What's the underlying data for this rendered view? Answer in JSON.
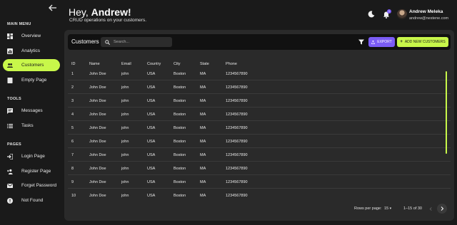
{
  "sidebar": {
    "sections": [
      {
        "title": "MAIN MENU",
        "items": [
          {
            "label": "Overview",
            "icon": "dashboard-icon",
            "active": false
          },
          {
            "label": "Analytics",
            "icon": "analytics-icon",
            "active": false
          },
          {
            "label": "Customers",
            "icon": "people-icon",
            "active": true
          },
          {
            "label": "Empty Page",
            "icon": "page-icon",
            "active": false
          }
        ]
      },
      {
        "title": "TOOLS",
        "items": [
          {
            "label": "Messages",
            "icon": "message-icon",
            "active": false
          },
          {
            "label": "Tasks",
            "icon": "list-icon",
            "active": false
          }
        ]
      },
      {
        "title": "PAGES",
        "items": [
          {
            "label": "Login Page",
            "icon": "login-icon",
            "active": false
          },
          {
            "label": "Register Page",
            "icon": "person-add-icon",
            "active": false
          },
          {
            "label": "Forget Password",
            "icon": "mail-icon",
            "active": false
          },
          {
            "label": "Not Found",
            "icon": "error-icon",
            "active": false
          }
        ]
      }
    ]
  },
  "header": {
    "greeting": "Hey,",
    "name": "Andrew!",
    "subtitle": "CRUD operations on your customers."
  },
  "user": {
    "name": "Andrew Meleka",
    "email": "andrew@nestene.com",
    "notifications": "1"
  },
  "toolbar": {
    "title": "Customers",
    "search_placeholder": "Search...",
    "export_label": "EXPORT",
    "add_label": "ADD NEW CUSTOMERS"
  },
  "table": {
    "headers": [
      "ID",
      "Name",
      "Email",
      "Country",
      "City",
      "State",
      "Phone"
    ],
    "rows": [
      [
        "1",
        "John Doe",
        "john",
        "USA",
        "Boston",
        "MA",
        "1234567890"
      ],
      [
        "2",
        "John Doe",
        "john",
        "USA",
        "Boston",
        "MA",
        "1234567890"
      ],
      [
        "3",
        "John Doe",
        "john",
        "USA",
        "Boston",
        "MA",
        "1234567890"
      ],
      [
        "4",
        "John Doe",
        "john",
        "USA",
        "Boston",
        "MA",
        "1234567890"
      ],
      [
        "5",
        "John Doe",
        "john",
        "USA",
        "Boston",
        "MA",
        "1234567890"
      ],
      [
        "6",
        "John Doe",
        "john",
        "USA",
        "Boston",
        "MA",
        "1234567890"
      ],
      [
        "7",
        "John Doe",
        "john",
        "USA",
        "Boston",
        "MA",
        "1234567890"
      ],
      [
        "8",
        "John Doe",
        "john",
        "USA",
        "Boston",
        "MA",
        "1234567890"
      ],
      [
        "9",
        "John Doe",
        "john",
        "USA",
        "Boston",
        "MA",
        "1234567890"
      ],
      [
        "10",
        "John Doe",
        "john",
        "USA",
        "Boston",
        "MA",
        "1234567890"
      ]
    ]
  },
  "pagination": {
    "rows_per_page_label": "Rows per page:",
    "rows_per_page": "15",
    "range": "1–15 of 30"
  },
  "colors": {
    "accent": "#c8f74a",
    "purple": "#7b5cf5",
    "background": "#1a1a1a",
    "panel": "#2a2a2a"
  }
}
